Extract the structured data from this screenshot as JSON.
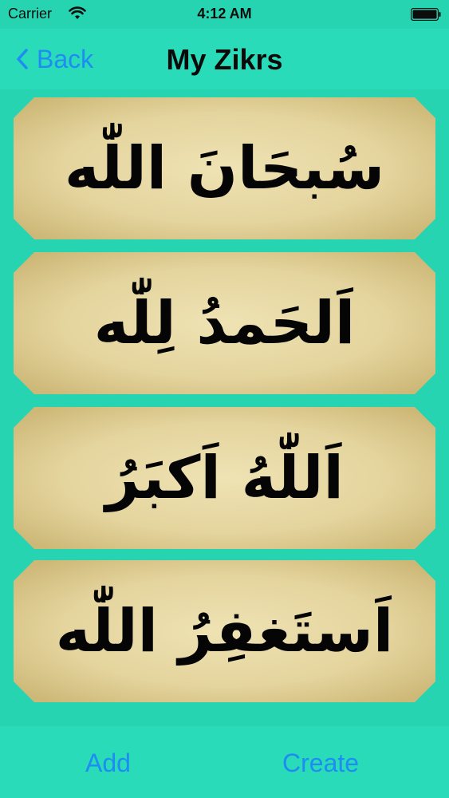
{
  "status_bar": {
    "carrier": "Carrier",
    "time": "4:12 AM"
  },
  "nav": {
    "back_label": "Back",
    "title": "My Zikrs"
  },
  "zikrs": [
    {
      "text": "سُبحَانَ اللّٰه"
    },
    {
      "text": "اَلحَمدُ لِلّٰه"
    },
    {
      "text": "اَللّٰهُ اَكبَرُ"
    },
    {
      "text": "اَستَغفِرُ اللّٰه"
    }
  ],
  "toolbar": {
    "add_label": "Add",
    "create_label": "Create"
  },
  "colors": {
    "background": "#26d4b2",
    "accent": "#1e8cf2",
    "parchment": "#e3d49c"
  }
}
